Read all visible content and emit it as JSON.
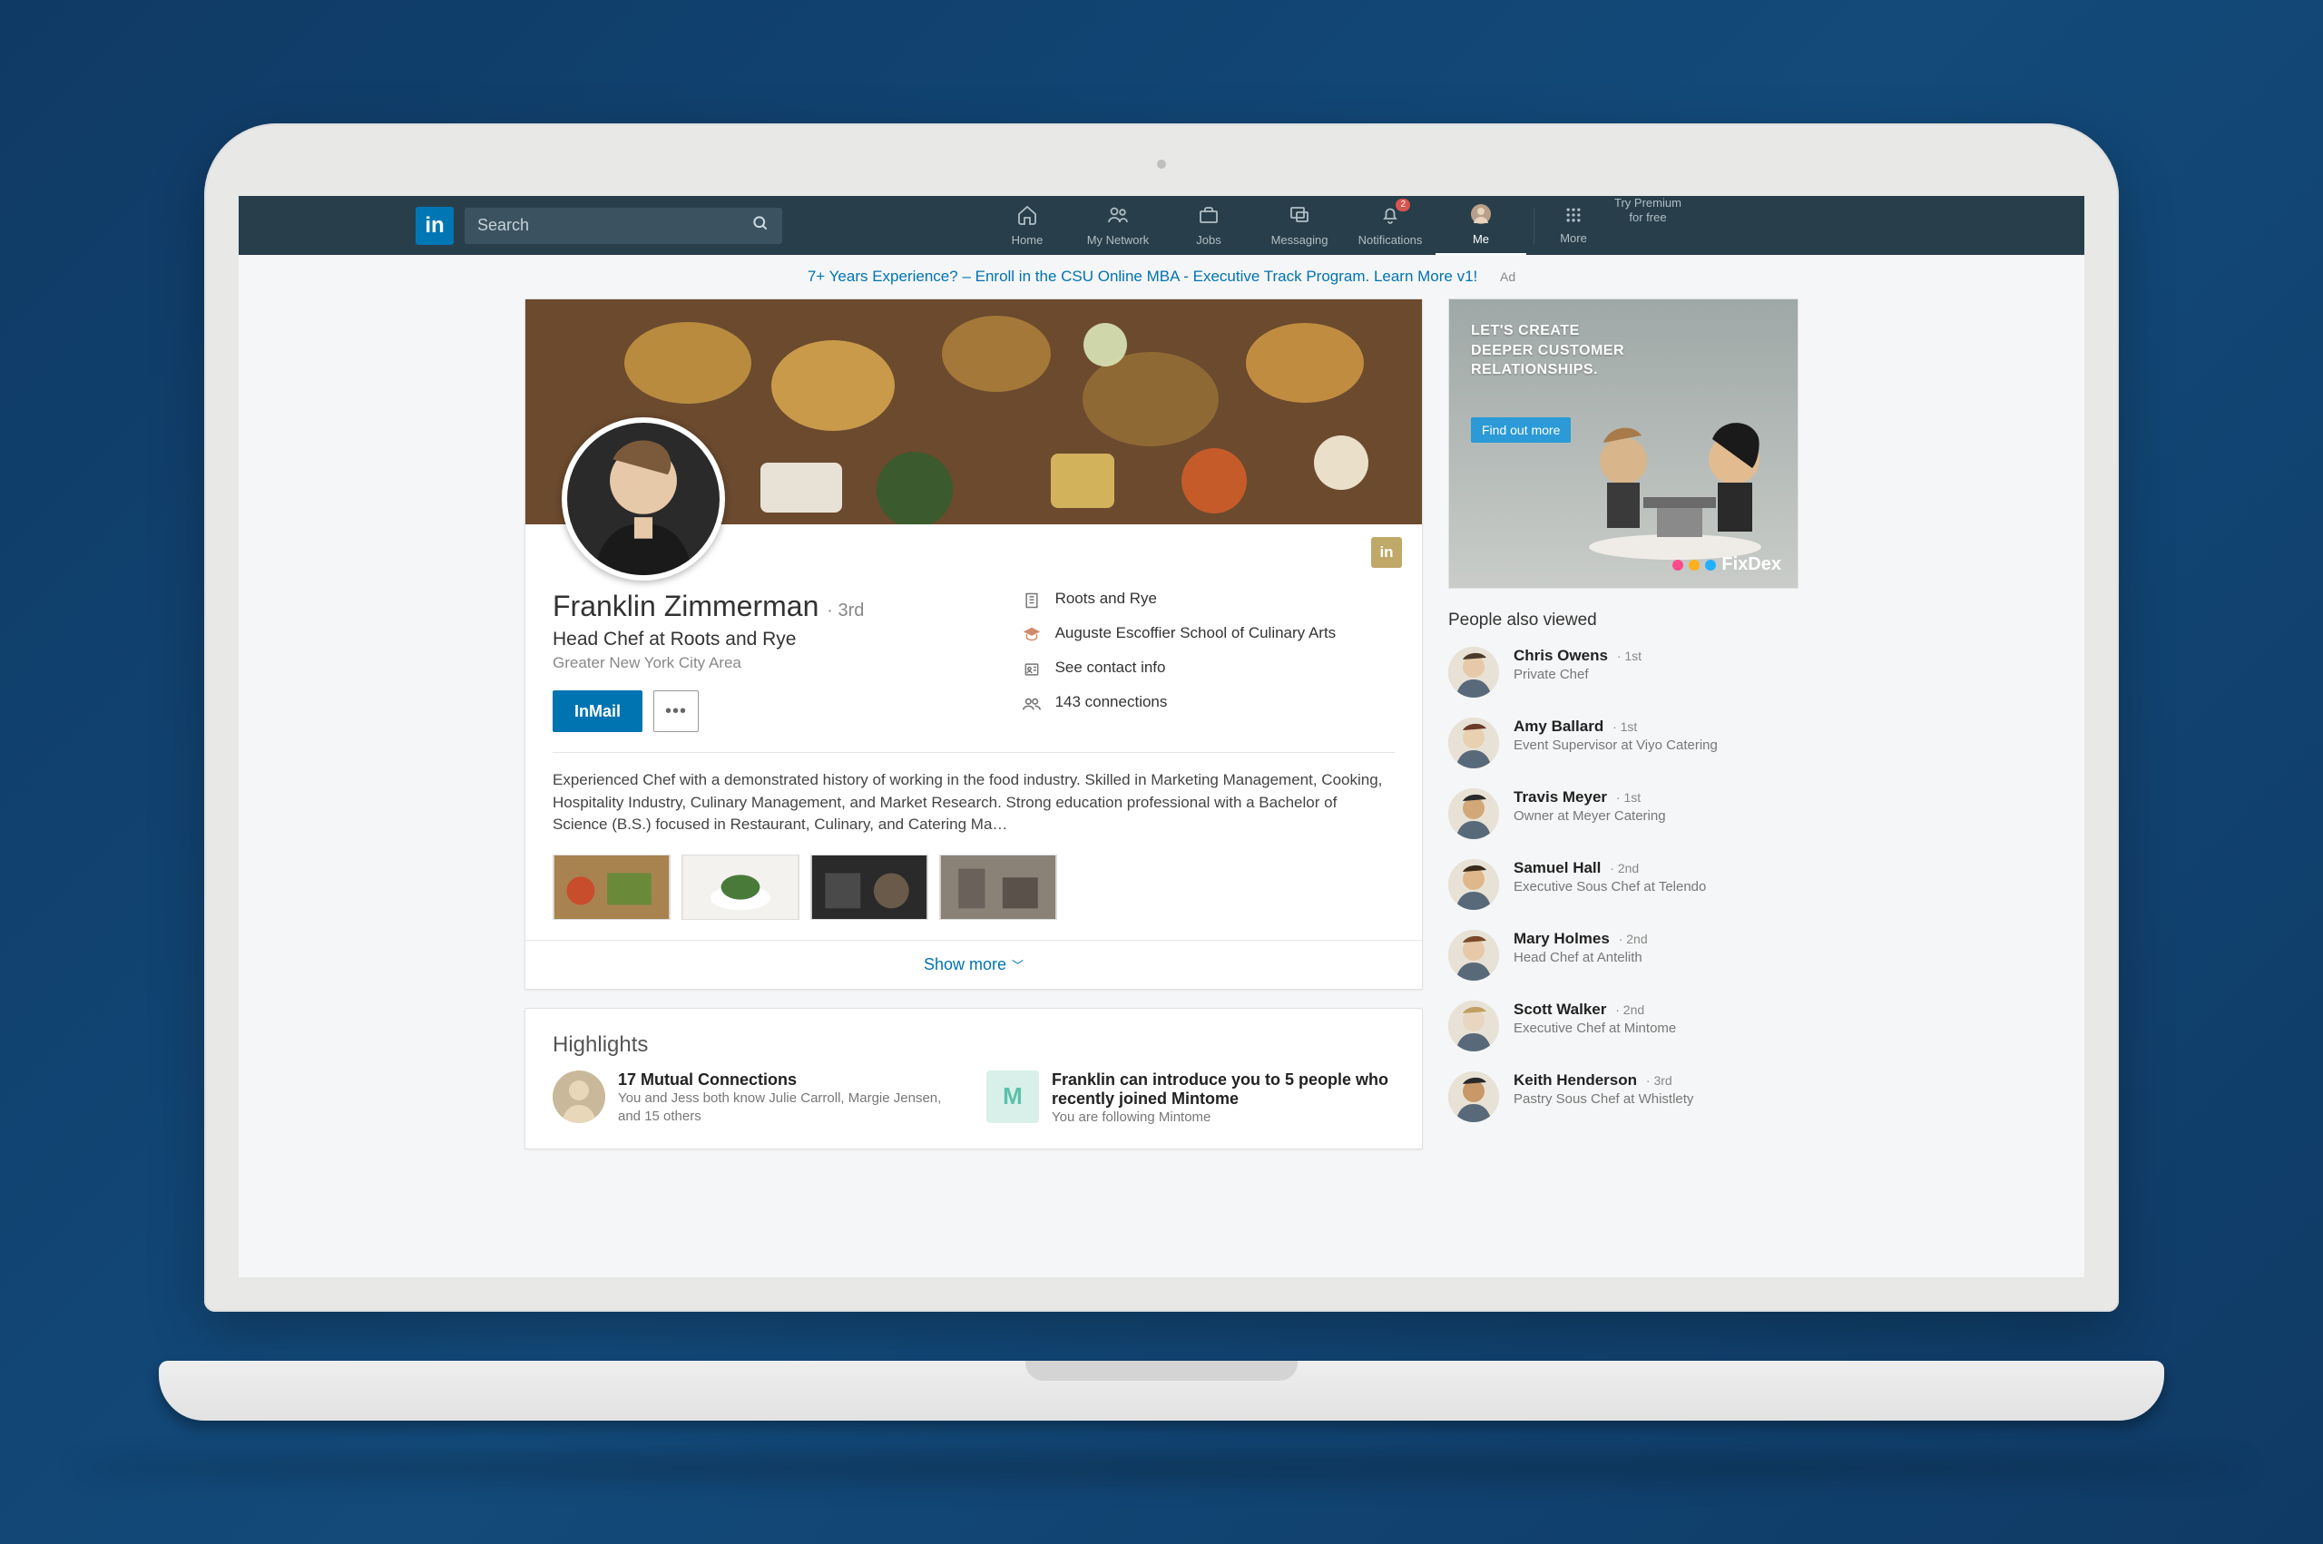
{
  "nav": {
    "search_placeholder": "Search",
    "items": [
      {
        "label": "Home"
      },
      {
        "label": "My Network"
      },
      {
        "label": "Jobs"
      },
      {
        "label": "Messaging"
      },
      {
        "label": "Notifications",
        "badge": "2"
      },
      {
        "label": "Me"
      },
      {
        "label": "More"
      }
    ],
    "premium_l1": "Try Premium",
    "premium_l2": "for free"
  },
  "promo": {
    "text": "7+ Years Experience? – Enroll in the CSU Online MBA - Executive Track Program. Learn More v1!",
    "ad_label": "Ad"
  },
  "profile": {
    "name": "Franklin Zimmerman",
    "degree": "· 3rd",
    "headline": "Head Chef at Roots and Rye",
    "location": "Greater New York City Area",
    "inmail_label": "InMail",
    "company": "Roots and Rye",
    "school": "Auguste Escoffier School of Culinary Arts",
    "contact_label": "See contact info",
    "connections": "143 connections",
    "summary": "Experienced Chef with a demonstrated history of working in the food industry. Skilled in Marketing Management, Cooking, Hospitality Industry, Culinary Management, and Market Research. Strong education professional with a Bachelor of Science (B.S.) focused in Restaurant, Culinary, and Catering Ma…",
    "show_more": "Show more"
  },
  "highlights": {
    "title": "Highlights",
    "items": [
      {
        "title": "17 Mutual Connections",
        "sub": "You and Jess both know Julie Carroll, Margie Jensen, and 15 others"
      },
      {
        "title": "Franklin can introduce you to 5 people who recently joined Mintome",
        "sub": "You are following Mintome"
      }
    ]
  },
  "ad": {
    "line1": "LET'S CREATE",
    "line2": "DEEPER CUSTOMER",
    "line3": "RELATIONSHIPS.",
    "cta": "Find out more",
    "brand": "FixDex"
  },
  "pav": {
    "title": "People also viewed",
    "items": [
      {
        "name": "Chris Owens",
        "deg": "· 1st",
        "sub": "Private Chef"
      },
      {
        "name": "Amy Ballard",
        "deg": "· 1st",
        "sub": "Event Supervisor at Viyo Catering"
      },
      {
        "name": "Travis Meyer",
        "deg": "· 1st",
        "sub": "Owner at Meyer Catering"
      },
      {
        "name": "Samuel Hall",
        "deg": "· 2nd",
        "sub": "Executive Sous Chef at Telendo"
      },
      {
        "name": "Mary Holmes",
        "deg": "· 2nd",
        "sub": "Head Chef at Antelith"
      },
      {
        "name": "Scott Walker",
        "deg": "· 2nd",
        "sub": "Executive Chef at Mintome"
      },
      {
        "name": "Keith Henderson",
        "deg": "· 3rd",
        "sub": "Pastry Sous Chef at Whistlety"
      }
    ]
  }
}
